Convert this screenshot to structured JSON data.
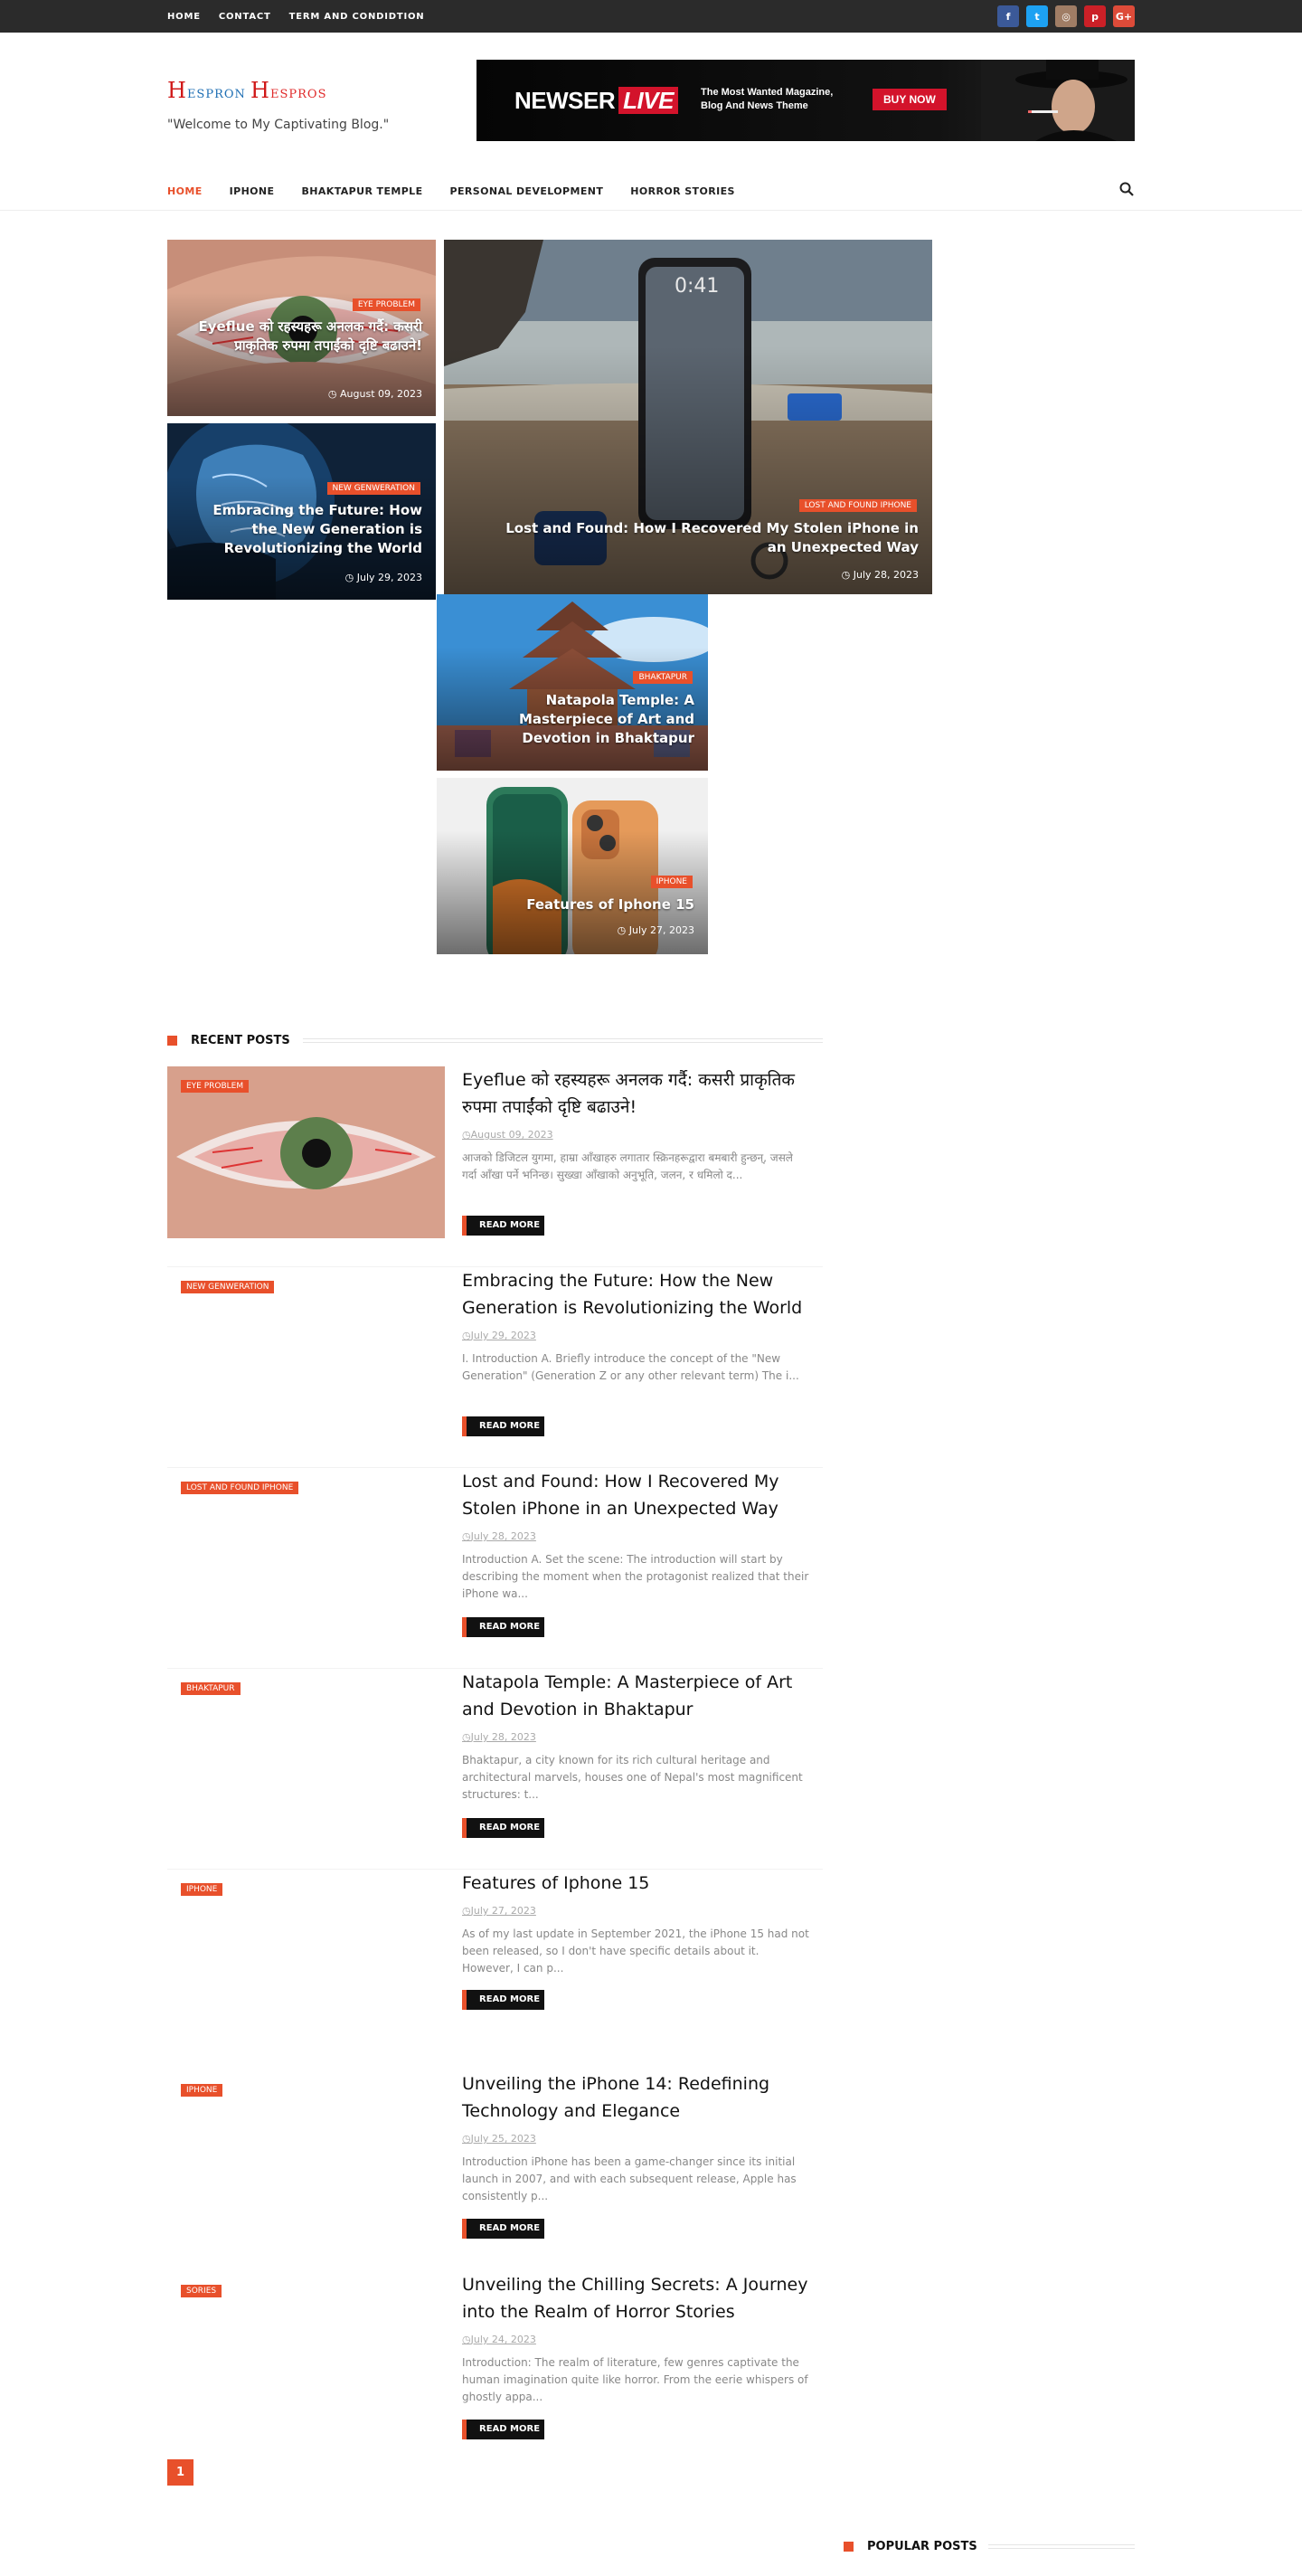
{
  "topbar": {
    "links": [
      "HOME",
      "CONTACT",
      "TERM AND CONDIDTION"
    ],
    "social": [
      {
        "icon": "facebook-icon",
        "glyph": "f",
        "color": "#3b5998"
      },
      {
        "icon": "twitter-icon",
        "glyph": "t",
        "color": "#1da1f2"
      },
      {
        "icon": "instagram-icon",
        "glyph": "◎",
        "color": "#a07d65"
      },
      {
        "icon": "pinterest-icon",
        "glyph": "p",
        "color": "#cb2027"
      },
      {
        "icon": "google-plus-icon",
        "glyph": "G+",
        "color": "#dd4b39"
      }
    ]
  },
  "header": {
    "logo_h1": "H",
    "logo_word1": "ESPRON",
    "logo_h2": "H",
    "logo_word2": "ESPROS",
    "tagline": "\"Welcome to My Captivating Blog.\""
  },
  "ad": {
    "brand": "NEWSER",
    "brand_accent": "LIVE",
    "slogan": "The Most Wanted Magazine, Blog And News Theme",
    "button": "BUY NOW"
  },
  "nav": {
    "items": [
      "HOME",
      "IPHONE",
      "BHAKTAPUR TEMPLE",
      "PERSONAL DEVELOPMENT",
      "HORROR STORIES"
    ],
    "active": "HOME",
    "search_icon": "search-icon"
  },
  "featured": [
    {
      "category": "EYE PROBLEM",
      "title": "Eyeflue को रहस्यहरू अनलक गर्दै: कसरी प्राकृतिक रुपमा तपाईंको दृष्टि बढाउने!",
      "date": "August 09, 2023"
    },
    {
      "category": "NEW GENWERATION",
      "title": "Embracing the Future: How the New Generation is Revolutionizing the World",
      "date": "July 29, 2023"
    },
    {
      "category": "LOST AND FOUND IPHONE",
      "title": "Lost and Found: How I Recovered My Stolen iPhone in an Unexpected Way",
      "date": "July 28, 2023"
    },
    {
      "category": "BHAKTAPUR",
      "title": "Natapola Temple: A Masterpiece of Art and Devotion in Bhaktapur",
      "date": ""
    },
    {
      "category": "IPHONE",
      "title": "Features of Iphone 15",
      "date": "July 27, 2023"
    }
  ],
  "recent": {
    "heading": "RECENT POSTS",
    "read_more": "READ MORE",
    "posts": [
      {
        "category": "EYE PROBLEM",
        "title": "Eyeflue को रहस्यहरू अनलक गर्दै: कसरी प्राकृतिक रुपमा तपाईंको दृष्टि बढाउने!",
        "date": "August 09, 2023",
        "excerpt": "आजको डिजिटल युगमा, हाम्रा आँखाहरु लगातार स्क्रिनहरूद्वारा बमबारी हुन्छन्, जसले गर्दा आँखा पर्ने भनिन्छ। सुख्खा आँखाको अनुभूति, जलन, र धमिलो द..."
      },
      {
        "category": "NEW GENWERATION",
        "title": "Embracing the Future: How the New Generation is Revolutionizing the World",
        "date": "July 29, 2023",
        "excerpt": "I. Introduction    A. Briefly introduce the concept of the \"New Generation\" (Generation Z or any other relevant term)    The i..."
      },
      {
        "category": "LOST AND FOUND IPHONE",
        "title": "Lost and Found: How I Recovered My Stolen iPhone in an Unexpected Way",
        "date": "July 28, 2023",
        "excerpt": "  Introduction    A. Set the scene: The introduction will start by describing the moment when the protagonist realized that their iPhone wa..."
      },
      {
        "category": "BHAKTAPUR",
        "title": "Natapola Temple: A Masterpiece of Art and Devotion in Bhaktapur",
        "date": "July 28, 2023",
        "excerpt": "  Bhaktapur, a city known for its rich cultural heritage and architectural marvels, houses one of Nepal's most magnificent structures: t..."
      },
      {
        "category": "IPHONE",
        "title": "Features of Iphone 15",
        "date": "July 27, 2023",
        "excerpt": "As of my last update in September 2021, the iPhone 15 had not been released, so I don't have specific details about it. However, I can p..."
      },
      {
        "category": "IPHONE",
        "title": "Unveiling the iPhone 14: Redefining Technology and Elegance",
        "date": "July 25, 2023",
        "excerpt": "    Introduction iPhone has been a game-changer since its initial launch in 2007, and with each subsequent release, Apple has consistently p..."
      },
      {
        "category": "SORIES",
        "title": "Unveiling the Chilling Secrets: A Journey into the Realm of Horror Stories",
        "date": "July 24, 2023",
        "excerpt": "Introduction: The realm of literature, few genres captivate the human imagination quite like horror. From the eerie whispers of ghostly appa..."
      }
    ]
  },
  "pagination": {
    "current": "1"
  },
  "sidebar": {
    "popular_heading": "POPULAR POSTS"
  }
}
